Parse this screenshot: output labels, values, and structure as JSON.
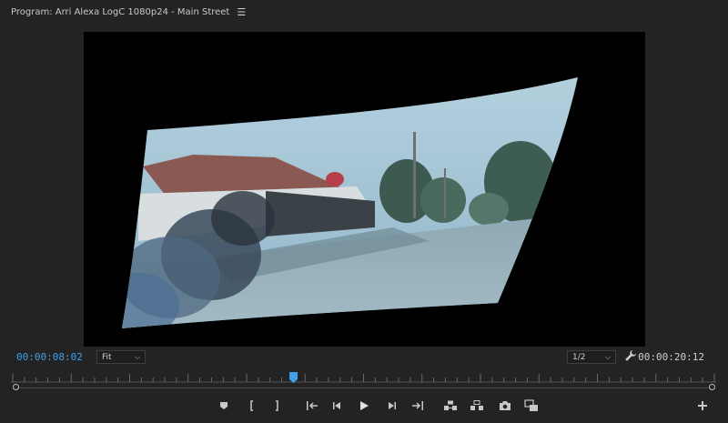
{
  "panel": {
    "title": "Program: Arri Alexa LogC 1080p24 - Main Street",
    "menu_icon": "hamburger-menu-icon"
  },
  "timecode": {
    "current": "00:00:08:02",
    "duration": "00:00:20:12",
    "current_color": "#3f9fe8"
  },
  "controls": {
    "zoom": {
      "selected": "Fit"
    },
    "resolution": {
      "selected": "1/2"
    },
    "settings_icon": "wrench-icon"
  },
  "timeline": {
    "playhead_position": 0.4,
    "playhead_color": "#3f9fe8"
  },
  "transport": {
    "buttons": [
      "add-marker-icon",
      "mark-in-icon",
      "mark-out-icon",
      "go-to-in-icon",
      "step-back-icon",
      "play-icon",
      "step-forward-icon",
      "go-to-out-icon",
      "lift-icon",
      "extract-icon",
      "export-frame-icon",
      "comparison-view-icon"
    ],
    "add_button_icon": "plus-icon"
  }
}
